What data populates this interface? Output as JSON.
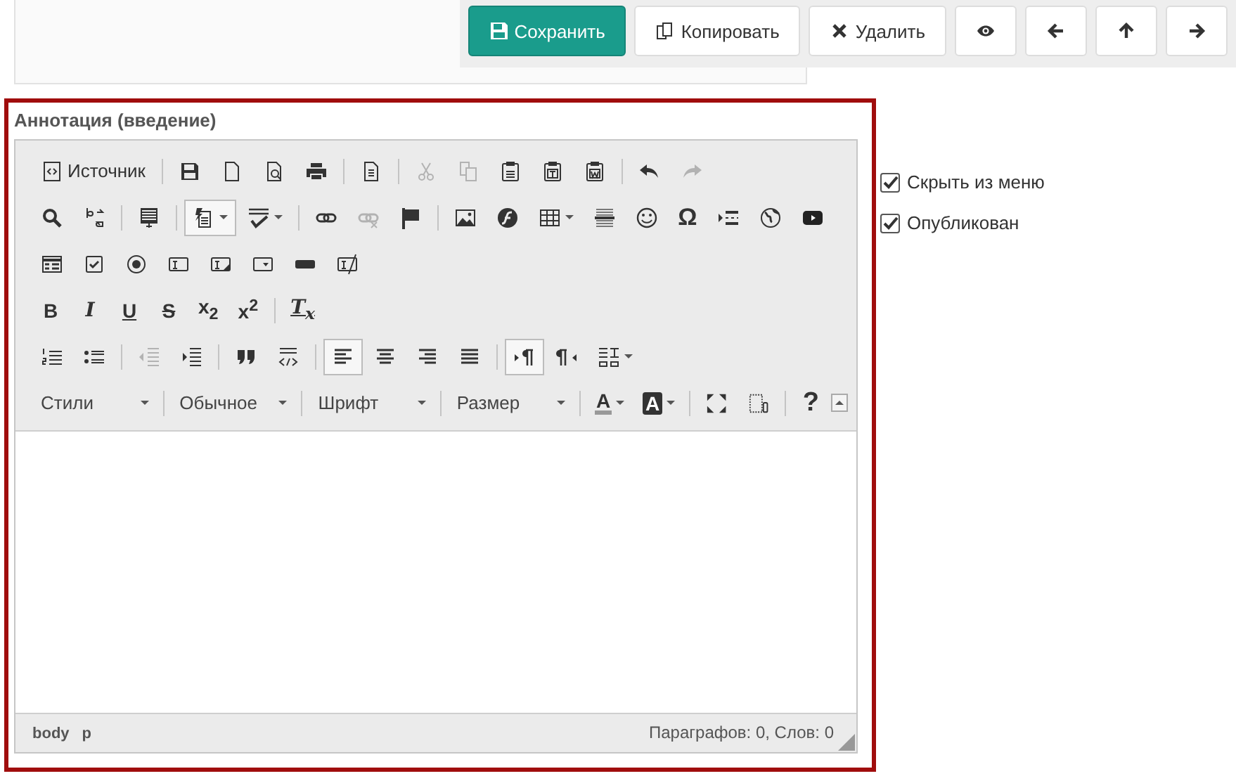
{
  "actions": [
    {
      "kind": "primary",
      "label": "Сохранить"
    },
    {
      "kind": "copy",
      "label": "Копировать"
    },
    {
      "kind": "delete",
      "label": "Удалить"
    },
    {
      "kind": "view"
    },
    {
      "kind": "back"
    },
    {
      "kind": "up"
    },
    {
      "kind": "forward"
    }
  ],
  "options": [
    {
      "label": "Скрыть из меню",
      "checked": true
    },
    {
      "label": "Опубликован",
      "checked": true
    }
  ],
  "editor": {
    "label": "Аннотация (введение)",
    "toolbar": {
      "rows": [
        {
          "groups": [
            {
              "buttons": [
                {
                  "kind": "text-button",
                  "label": "Источник",
                  "disabled": false,
                  "selected": false
                }
              ]
            },
            {
              "buttons": [
                {
                  "kind": "icon",
                  "disabled": false,
                  "selected": false
                },
                {
                  "kind": "icon",
                  "disabled": false,
                  "selected": false
                },
                {
                  "kind": "icon",
                  "disabled": false,
                  "selected": false
                },
                {
                  "kind": "icon",
                  "disabled": false,
                  "selected": false
                }
              ]
            },
            {
              "buttons": [
                {
                  "kind": "icon",
                  "disabled": false,
                  "selected": false
                }
              ]
            },
            {
              "buttons": [
                {
                  "kind": "icon",
                  "disabled": true,
                  "selected": false
                },
                {
                  "kind": "icon",
                  "disabled": true,
                  "selected": false
                },
                {
                  "kind": "icon",
                  "disabled": false,
                  "selected": false
                },
                {
                  "kind": "icon",
                  "disabled": false,
                  "selected": false
                },
                {
                  "kind": "icon",
                  "disabled": false,
                  "selected": false
                }
              ]
            },
            {
              "buttons": [
                {
                  "kind": "icon",
                  "disabled": false,
                  "selected": false
                },
                {
                  "kind": "icon",
                  "disabled": true,
                  "selected": false
                }
              ]
            }
          ]
        },
        {
          "groups": [
            {
              "buttons": [
                {
                  "kind": "icon",
                  "disabled": false,
                  "selected": false
                },
                {
                  "kind": "icon",
                  "disabled": false,
                  "selected": false
                }
              ]
            },
            {
              "buttons": [
                {
                  "kind": "icon",
                  "disabled": false,
                  "selected": false
                }
              ]
            },
            {
              "buttons": [
                {
                  "kind": "icon",
                  "disabled": false,
                  "selected": true
                },
                {
                  "kind": "icon",
                  "disabled": false,
                  "selected": false
                }
              ]
            },
            {
              "buttons": [
                {
                  "kind": "icon",
                  "disabled": false,
                  "selected": false
                },
                {
                  "kind": "icon",
                  "disabled": true,
                  "selected": false
                },
                {
                  "kind": "icon",
                  "disabled": false,
                  "selected": false
                }
              ]
            },
            {
              "buttons": [
                {
                  "kind": "icon",
                  "disabled": false,
                  "selected": false
                },
                {
                  "kind": "icon",
                  "disabled": false,
                  "selected": false
                },
                {
                  "kind": "icon",
                  "disabled": false,
                  "selected": false
                },
                {
                  "kind": "icon",
                  "disabled": false,
                  "selected": false
                },
                {
                  "kind": "icon",
                  "disabled": false,
                  "selected": false
                },
                {
                  "kind": "glyph",
                  "glyph": "Ω",
                  "disabled": false,
                  "selected": false
                },
                {
                  "kind": "icon",
                  "disabled": false,
                  "selected": false
                },
                {
                  "kind": "icon",
                  "disabled": false,
                  "selected": false
                },
                {
                  "kind": "icon",
                  "disabled": false,
                  "selected": false
                }
              ]
            }
          ]
        },
        {
          "groups": [
            {
              "buttons": [
                {
                  "kind": "icon",
                  "disabled": false,
                  "selected": false
                },
                {
                  "kind": "icon",
                  "disabled": false,
                  "selected": false
                },
                {
                  "kind": "icon",
                  "disabled": false,
                  "selected": false
                },
                {
                  "kind": "icon",
                  "disabled": false,
                  "selected": false
                },
                {
                  "kind": "icon",
                  "disabled": false,
                  "selected": false
                },
                {
                  "kind": "icon",
                  "disabled": false,
                  "selected": false
                },
                {
                  "kind": "icon",
                  "disabled": false,
                  "selected": false
                },
                {
                  "kind": "icon",
                  "disabled": false,
                  "selected": false
                }
              ]
            }
          ]
        },
        {
          "groups": [
            {
              "buttons": [
                {
                  "kind": "glyph",
                  "glyph": "B",
                  "disabled": false,
                  "selected": false
                },
                {
                  "kind": "glyph",
                  "glyph": "I",
                  "disabled": false,
                  "selected": false
                },
                {
                  "kind": "glyph",
                  "glyph": "U",
                  "disabled": false,
                  "selected": false
                },
                {
                  "kind": "glyph",
                  "glyph": "S",
                  "disabled": false,
                  "selected": false
                },
                {
                  "kind": "glyph",
                  "glyph": "x$_{2}$",
                  "disabled": false,
                  "selected": false
                },
                {
                  "kind": "glyph",
                  "glyph": "x$^{2}$",
                  "disabled": false,
                  "selected": false
                }
              ]
            },
            {
              "buttons": [
                {
                  "kind": "glyph",
                  "glyph": "T$_{x}$",
                  "disabled": false,
                  "selected": false
                }
              ]
            }
          ]
        },
        {
          "groups": [
            {
              "buttons": [
                {
                  "kind": "icon",
                  "disabled": false,
                  "selected": false
                },
                {
                  "kind": "icon",
                  "disabled": false,
                  "selected": false
                }
              ]
            },
            {
              "buttons": [
                {
                  "kind": "icon",
                  "disabled": true,
                  "selected": false
                },
                {
                  "kind": "icon",
                  "disabled": false,
                  "selected": false
                }
              ]
            },
            {
              "buttons": [
                {
                  "kind": "icon",
                  "disabled": false,
                  "selected": false
                },
                {
                  "kind": "icon",
                  "disabled": false,
                  "selected": false
                }
              ]
            },
            {
              "buttons": [
                {
                  "kind": "icon",
                  "disabled": false,
                  "selected": true
                },
                {
                  "kind": "icon",
                  "disabled": false,
                  "selected": false
                },
                {
                  "kind": "icon",
                  "disabled": false,
                  "selected": false
                },
                {
                  "kind": "icon",
                  "disabled": false,
                  "selected": false
                }
              ]
            },
            {
              "buttons": [
                {
                  "kind": "icon",
                  "disabled": false,
                  "selected": true
                },
                {
                  "kind": "icon",
                  "disabled": false,
                  "selected": false
                },
                {
                  "kind": "icon",
                  "disabled": false,
                  "selected": false
                }
              ]
            }
          ]
        },
        {
          "groups": [
            {
              "buttons": [
                {
                  "kind": "combo",
                  "label": "Стили"
                }
              ]
            },
            {
              "buttons": [
                {
                  "kind": "combo",
                  "label": "Обычное"
                }
              ]
            },
            {
              "buttons": [
                {
                  "kind": "combo",
                  "label": "Шрифт"
                }
              ]
            },
            {
              "buttons": [
                {
                  "kind": "combo",
                  "label": "Размер"
                }
              ]
            },
            {
              "buttons": [
                {
                  "kind": "glyph",
                  "glyph": "A",
                  "disabled": false,
                  "selected": false
                },
                {
                  "kind": "glyph",
                  "glyph": "A",
                  "disabled": false,
                  "selected": false
                }
              ]
            },
            {
              "buttons": [
                {
                  "kind": "icon",
                  "disabled": false,
                  "selected": false
                },
                {
                  "kind": "icon",
                  "disabled": false,
                  "selected": false
                }
              ]
            },
            {
              "buttons": [
                {
                  "kind": "glyph",
                  "glyph": "?",
                  "disabled": false,
                  "selected": false
                }
              ]
            }
          ]
        }
      ]
    },
    "path": [
      "body",
      "p"
    ],
    "counter": "Параграфов: 0, Слов: 0"
  }
}
